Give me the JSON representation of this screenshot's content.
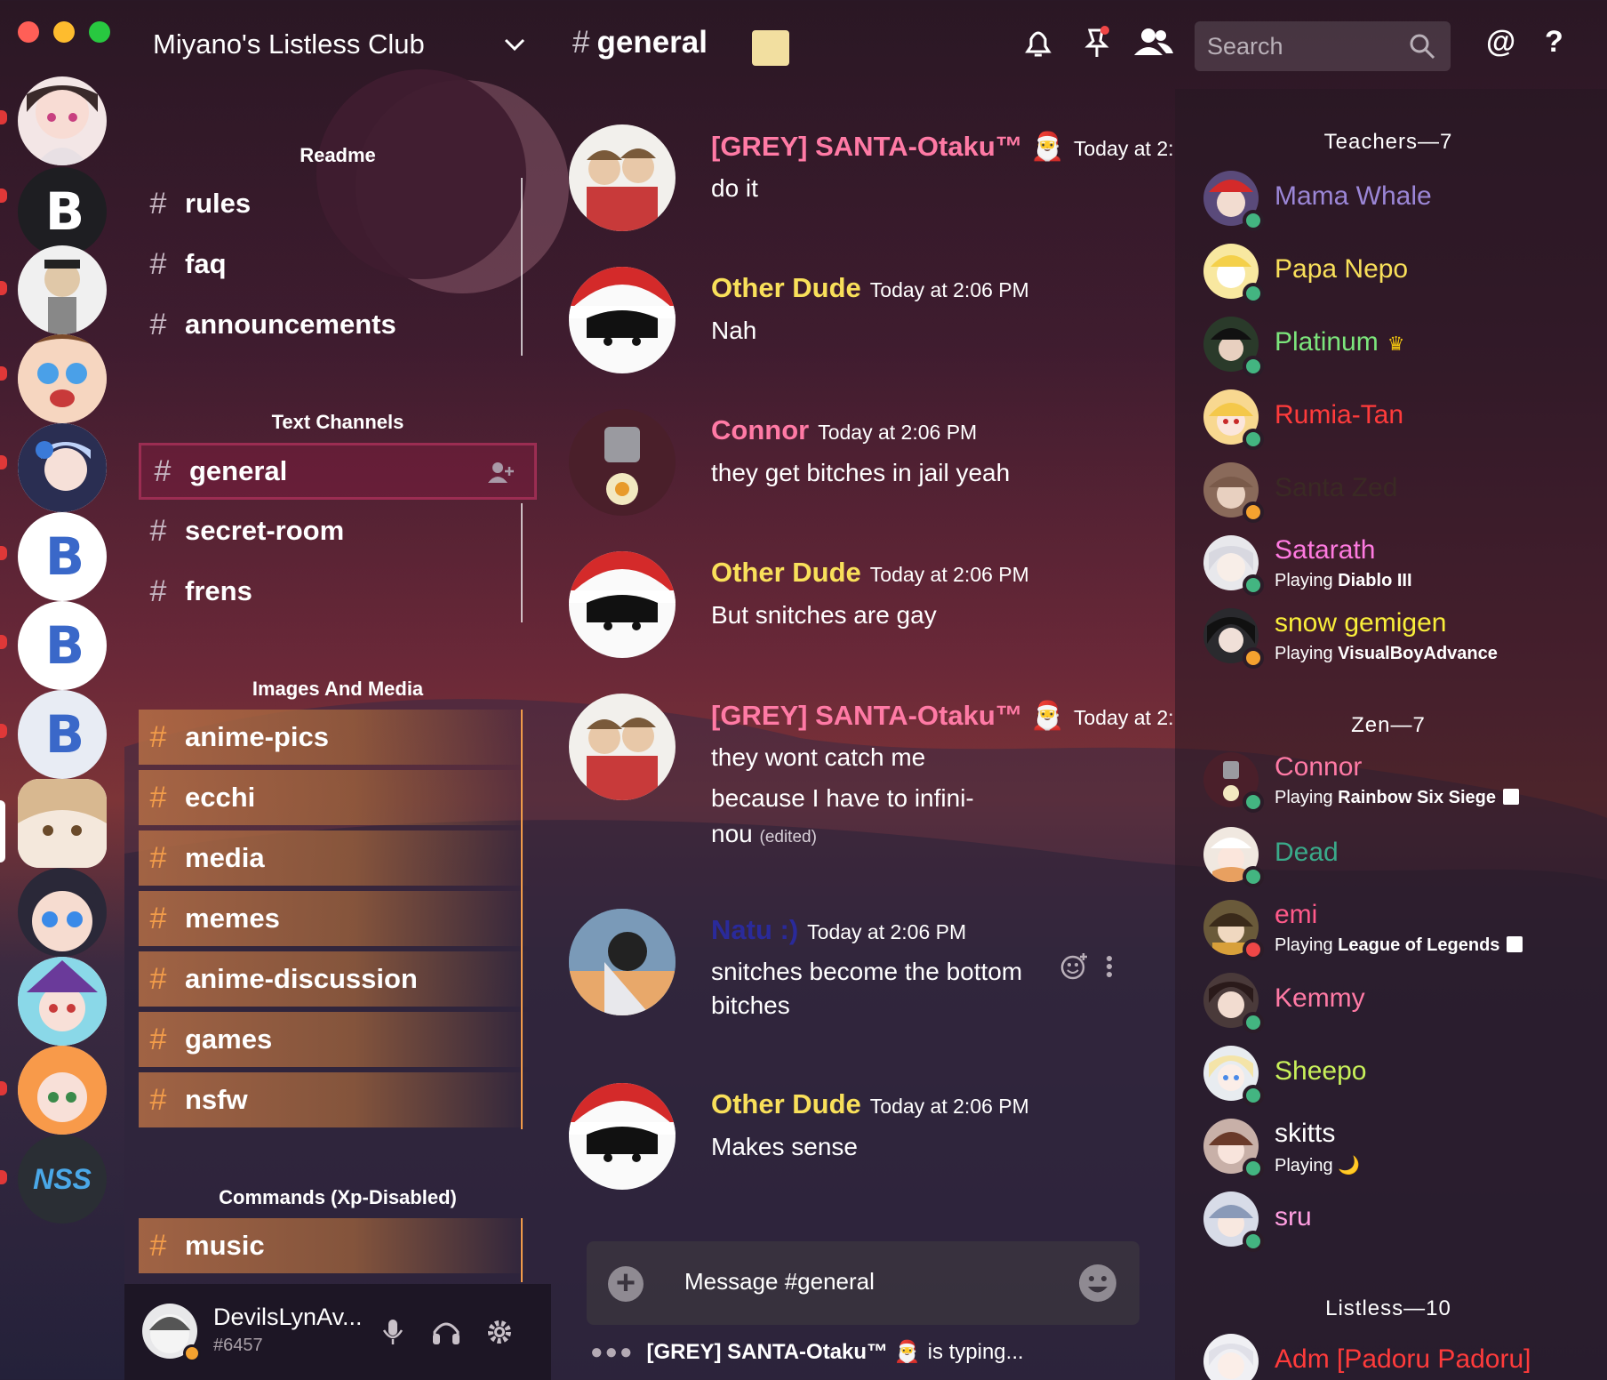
{
  "colors": {
    "mention_red": "#e03838",
    "accent_pink": "#9b2d52",
    "media_orange": "#f29c4a",
    "online": "#43b581",
    "idle": "#f4a22f",
    "dnd": "#f04747"
  },
  "guild": {
    "name": "Miyano's Listless Club"
  },
  "categories": [
    {
      "name": "Readme",
      "channels": [
        "rules",
        "faq",
        "announcements"
      ]
    },
    {
      "name": "Text Channels",
      "channels": [
        "general",
        "secret-room",
        "frens"
      ]
    },
    {
      "name": "Images And Media",
      "channels": [
        "anime-pics",
        "ecchi",
        "media",
        "memes",
        "anime-discussion",
        "games",
        "nsfw"
      ]
    },
    {
      "name": "Commands (Xp-Disabled)",
      "channels": [
        "music"
      ]
    }
  ],
  "servers": [
    {
      "label": "",
      "icon": "avatar-icon"
    },
    {
      "label": "B",
      "icon": "server-b-icon"
    },
    {
      "label": "",
      "icon": "avatar-icon"
    },
    {
      "label": "",
      "icon": "avatar-icon"
    },
    {
      "label": "",
      "icon": "avatar-icon"
    },
    {
      "label": "B",
      "icon": "server-b-icon"
    },
    {
      "label": "B",
      "icon": "server-b-icon"
    },
    {
      "label": "B",
      "icon": "server-b-icon"
    },
    {
      "label": "",
      "icon": "avatar-icon"
    },
    {
      "label": "",
      "icon": "avatar-icon"
    },
    {
      "label": "",
      "icon": "avatar-icon"
    },
    {
      "label": "",
      "icon": "avatar-icon"
    },
    {
      "label": "NSS",
      "icon": "server-nss-icon"
    }
  ],
  "user": {
    "name": "DevilsLynAv...",
    "tag": "#6457"
  },
  "header": {
    "channel": "general",
    "search_placeholder": "Search"
  },
  "messages": [
    {
      "author": "[GREY] SANTA-Otaku™ 🎅",
      "time": "Today at 2:",
      "color": "#ff7aa5",
      "lines": [
        "do it"
      ]
    },
    {
      "author": "Other Dude",
      "time": "Today at 2:06 PM",
      "color": "#f9e05a",
      "lines": [
        "Nah"
      ]
    },
    {
      "author": "Connor",
      "time": "Today at 2:06 PM",
      "color": "#ff7aa5",
      "lines": [
        "they get bitches in jail yeah"
      ]
    },
    {
      "author": "Other Dude",
      "time": "Today at 2:06 PM",
      "color": "#f9e05a",
      "lines": [
        "But snitches are gay"
      ]
    },
    {
      "author": "[GREY] SANTA-Otaku™ 🎅",
      "time": "Today at 2:",
      "color": "#ff7aa5",
      "lines": [
        "they wont catch me",
        "because I have to infini-",
        "nou"
      ],
      "edited": "(edited)"
    },
    {
      "author": "Natu :)",
      "time": "Today at 2:06 PM",
      "color": "#2a2a9a",
      "lines": [
        "snitches become the bottom",
        "bitches"
      ]
    },
    {
      "author": "Other Dude",
      "time": "Today at 2:06 PM",
      "color": "#f9e05a",
      "lines": [
        "Makes sense"
      ]
    }
  ],
  "composer": {
    "placeholder": "Message #general"
  },
  "typing": {
    "who": "[GREY] SANTA-Otaku™ 🎅",
    "text": "is typing..."
  },
  "member_groups": [
    {
      "name": "Teachers—7"
    },
    {
      "name": "Zen—7"
    },
    {
      "name": "Listless—10"
    }
  ],
  "members": [
    {
      "name": "Mama Whale",
      "color": "#9b86d6",
      "status": "online",
      "activity": ""
    },
    {
      "name": "Papa Nepo",
      "color": "#f9e05a",
      "status": "online",
      "activity": ""
    },
    {
      "name": "Platinum",
      "color": "#7ce57c",
      "status": "online",
      "activity": "",
      "crown": "♛"
    },
    {
      "name": "Rumia-Tan",
      "color": "#ff3b3b",
      "status": "online",
      "activity": ""
    },
    {
      "name": "Santa Zed",
      "color": "#3a2a24",
      "status": "idle",
      "activity": ""
    },
    {
      "name": "Satarath",
      "color": "#ff7ae0",
      "status": "online",
      "activity_prefix": "Playing",
      "activity": "Diablo III"
    },
    {
      "name": "snow gemigen",
      "color": "#f9ee3a",
      "status": "idle",
      "activity_prefix": "Playing",
      "activity": "VisualBoyAdvance"
    },
    {
      "name": "Connor",
      "color": "#ff7aa5",
      "status": "online",
      "activity_prefix": "Playing",
      "activity": "Rainbow Six Siege"
    },
    {
      "name": "Dead",
      "color": "#3aaa8a",
      "status": "online",
      "activity": ""
    },
    {
      "name": "emi",
      "color": "#ff5a8a",
      "status": "dnd",
      "activity_prefix": "Playing",
      "activity": "League of Legends"
    },
    {
      "name": "Kemmy",
      "color": "#ff7aa5",
      "status": "online",
      "activity": ""
    },
    {
      "name": "Sheepo",
      "color": "#c8f05a",
      "status": "online",
      "activity": ""
    },
    {
      "name": "skitts",
      "color": "#ffffff",
      "status": "online",
      "activity_prefix": "Playing",
      "activity": "🌙"
    },
    {
      "name": "sru",
      "color": "#ff9ee0",
      "status": "online",
      "activity": ""
    },
    {
      "name": "Adm [Padoru Padoru]",
      "color": "#ff3b3b",
      "status": "online",
      "activity": ""
    }
  ]
}
